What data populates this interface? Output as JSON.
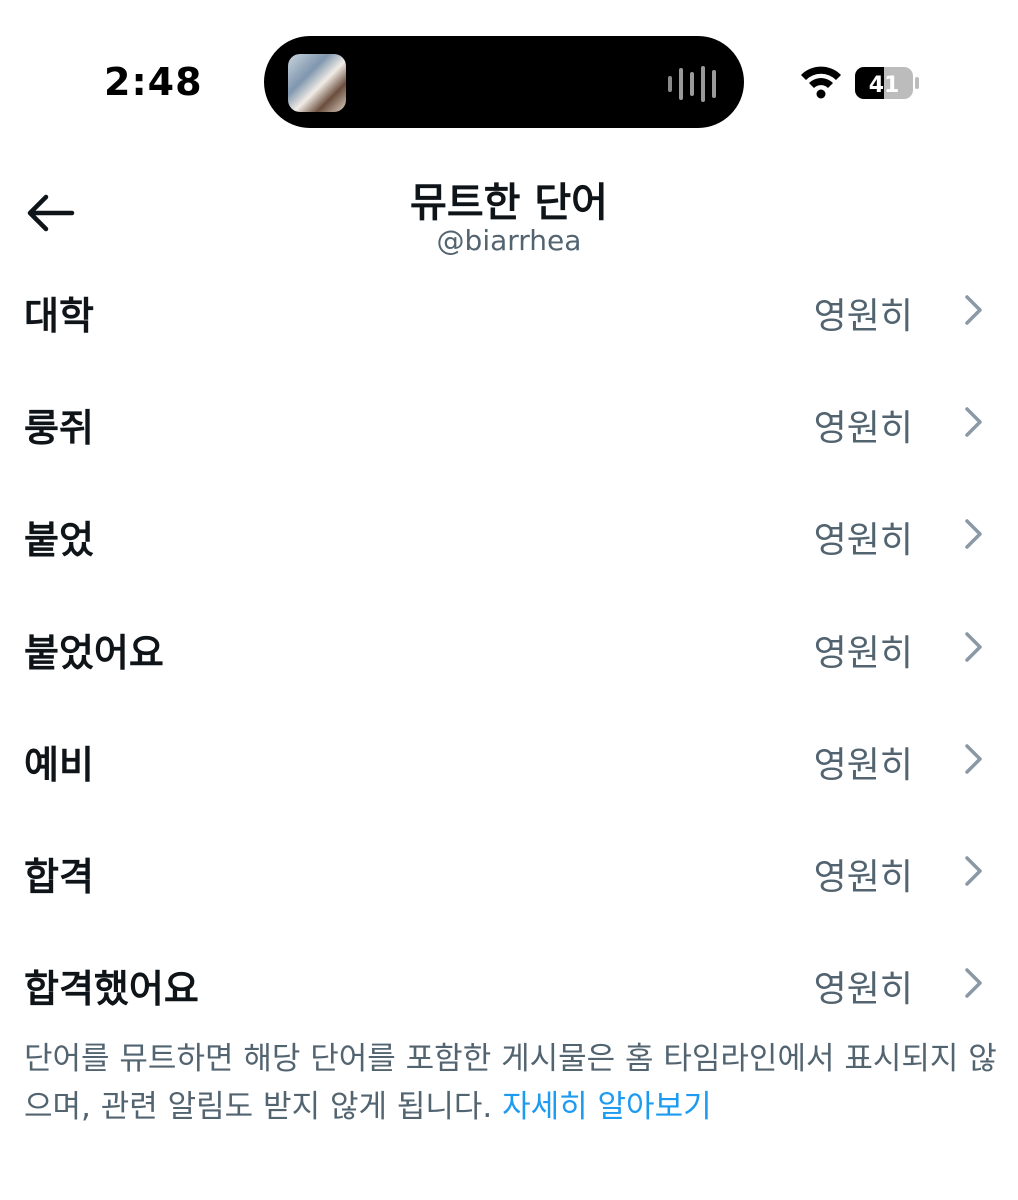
{
  "status_bar": {
    "time": "2:48",
    "battery_level": "41"
  },
  "header": {
    "title": "뮤트한 단어",
    "handle": "@biarrhea"
  },
  "muted_words": [
    {
      "word": "대학",
      "duration": "영원히"
    },
    {
      "word": "룽쥐",
      "duration": "영원히"
    },
    {
      "word": "붙었",
      "duration": "영원히"
    },
    {
      "word": "붙었어요",
      "duration": "영원히"
    },
    {
      "word": "예비",
      "duration": "영원히"
    },
    {
      "word": "합격",
      "duration": "영원히"
    },
    {
      "word": "합격했어요",
      "duration": "영원히"
    }
  ],
  "footer": {
    "note": "단어를 뮤트하면 해당 단어를 포함한 게시물은 홈 타임라인에서 표시되지 않으며, 관련 알림도 받지 않게 됩니다. ",
    "learn_more": "자세히 알아보기"
  },
  "colors": {
    "text_primary": "#0f1419",
    "text_secondary": "#536471",
    "link": "#1d9bf0"
  },
  "icons": {
    "back": "arrow-left-icon",
    "chevron": "chevron-right-icon",
    "wifi": "wifi-icon",
    "battery": "battery-icon",
    "audio": "audio-waveform-icon"
  }
}
